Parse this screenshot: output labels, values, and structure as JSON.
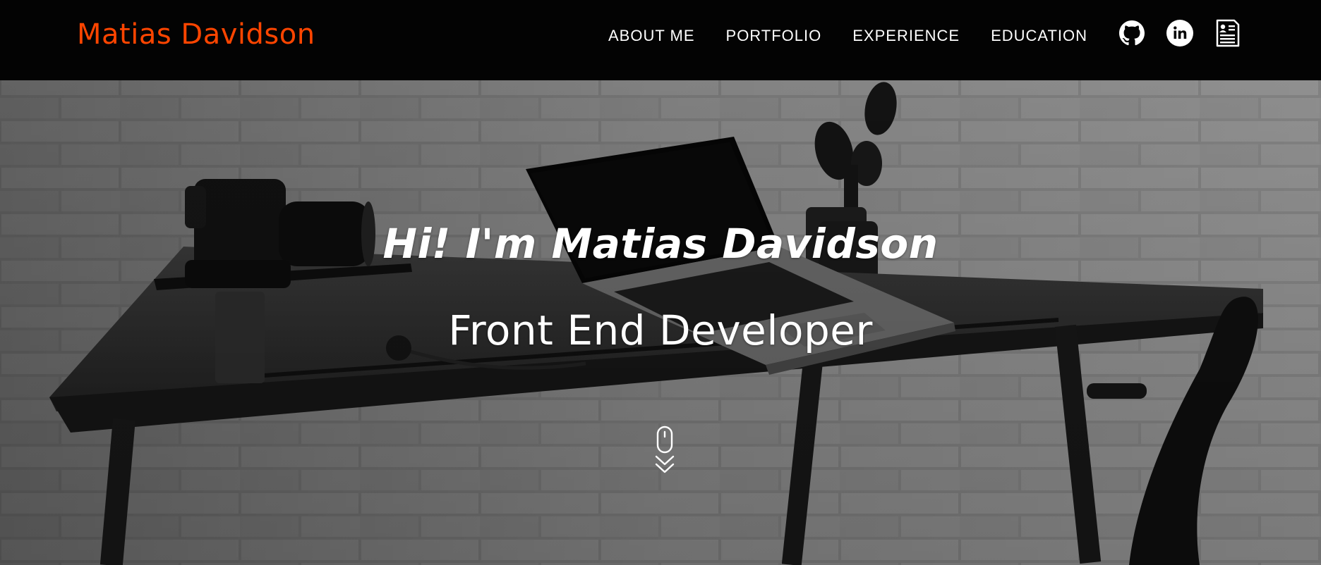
{
  "header": {
    "brand": "Matias Davidson",
    "nav": [
      {
        "label": "ABOUT ME"
      },
      {
        "label": "PORTFOLIO"
      },
      {
        "label": "EXPERIENCE"
      },
      {
        "label": "EDUCATION"
      }
    ],
    "social_icons": [
      "github-icon",
      "linkedin-icon",
      "resume-icon"
    ]
  },
  "hero": {
    "greeting": "Hi! I'm Matias Davidson",
    "role": "Front End Developer",
    "scroll_icon": "mouse-scroll-down-icon"
  },
  "colors": {
    "brand": "#ff4500",
    "navbar_bg": "#030303",
    "text": "#ffffff"
  }
}
